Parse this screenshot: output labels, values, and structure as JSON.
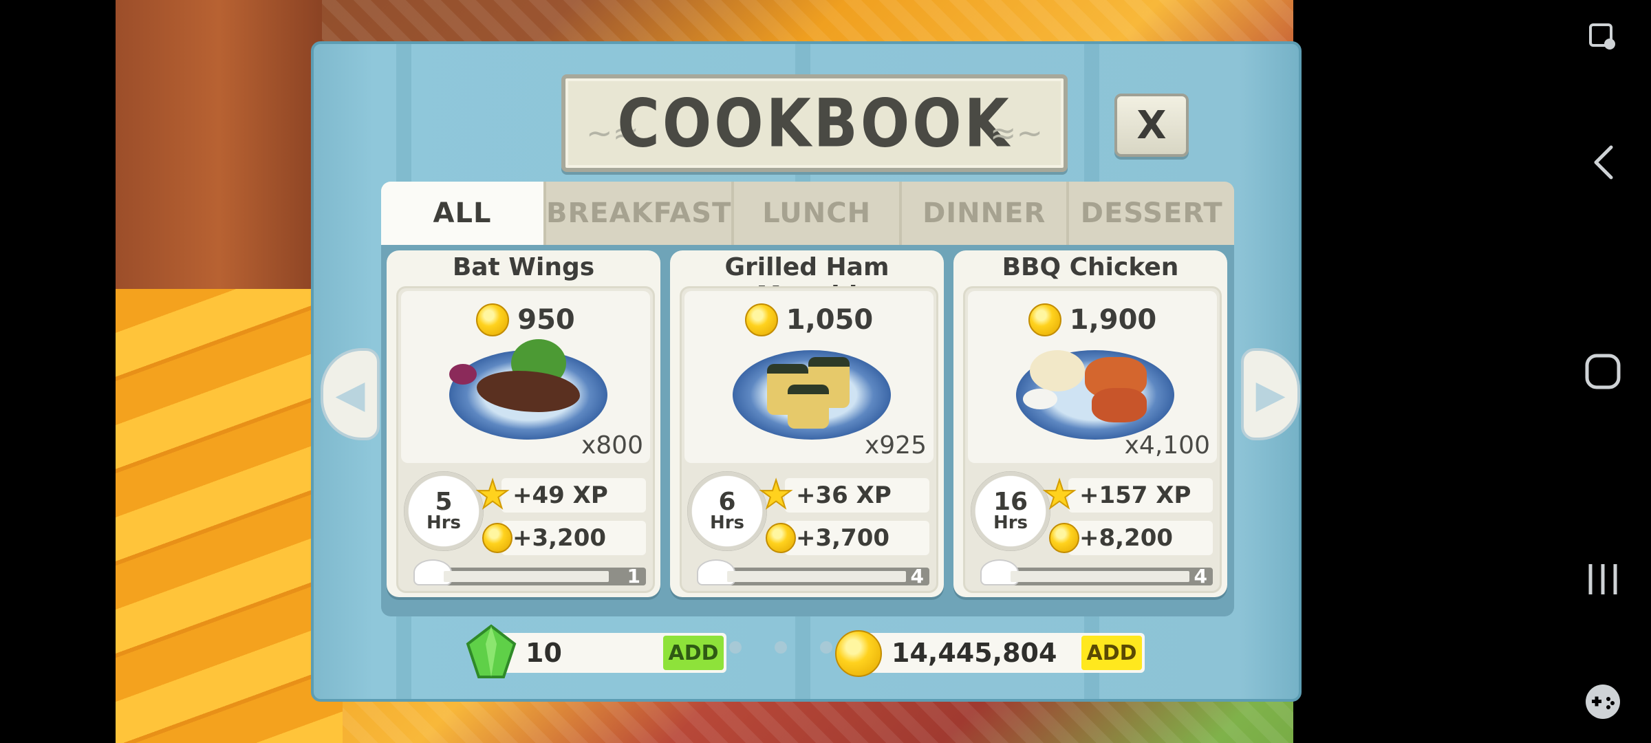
{
  "modal": {
    "title": "COOKBOOK",
    "close_label": "X",
    "tabs": [
      {
        "label": "ALL",
        "active": true
      },
      {
        "label": "BREAKFAST",
        "active": false
      },
      {
        "label": "LUNCH",
        "active": false
      },
      {
        "label": "DINNER",
        "active": false
      },
      {
        "label": "DESSERT",
        "active": false
      }
    ],
    "recipes": [
      {
        "name": "Bat Wings",
        "price": "950",
        "yield": "x800",
        "time": "5",
        "time_unit": "Hrs",
        "xp": "+49 XP",
        "coins": "+3,200",
        "level": "1"
      },
      {
        "name": "Grilled Ham Musubi",
        "price": "1,050",
        "yield": "x925",
        "time": "6",
        "time_unit": "Hrs",
        "xp": "+36 XP",
        "coins": "+3,700",
        "level": "4"
      },
      {
        "name": "BBQ Chicken",
        "price": "1,900",
        "yield": "x4,100",
        "time": "16",
        "time_unit": "Hrs",
        "xp": "+157 XP",
        "coins": "+8,200",
        "level": "4"
      }
    ],
    "pagination": {
      "total": 10,
      "current": 3
    },
    "gems": {
      "value": "10",
      "add_label": "ADD"
    },
    "coins": {
      "value": "14,445,804",
      "add_label": "ADD"
    }
  },
  "colors": {
    "gem_add": "#8ee23a",
    "coin_add": "#ffe81e",
    "panel": "#8dc3d6"
  },
  "icons": [
    "screen-record-icon",
    "back-icon",
    "home-icon",
    "recents-icon",
    "game-controller-icon",
    "coin-icon",
    "gem-icon",
    "star-icon",
    "timer-icon",
    "chef-hat-icon"
  ]
}
